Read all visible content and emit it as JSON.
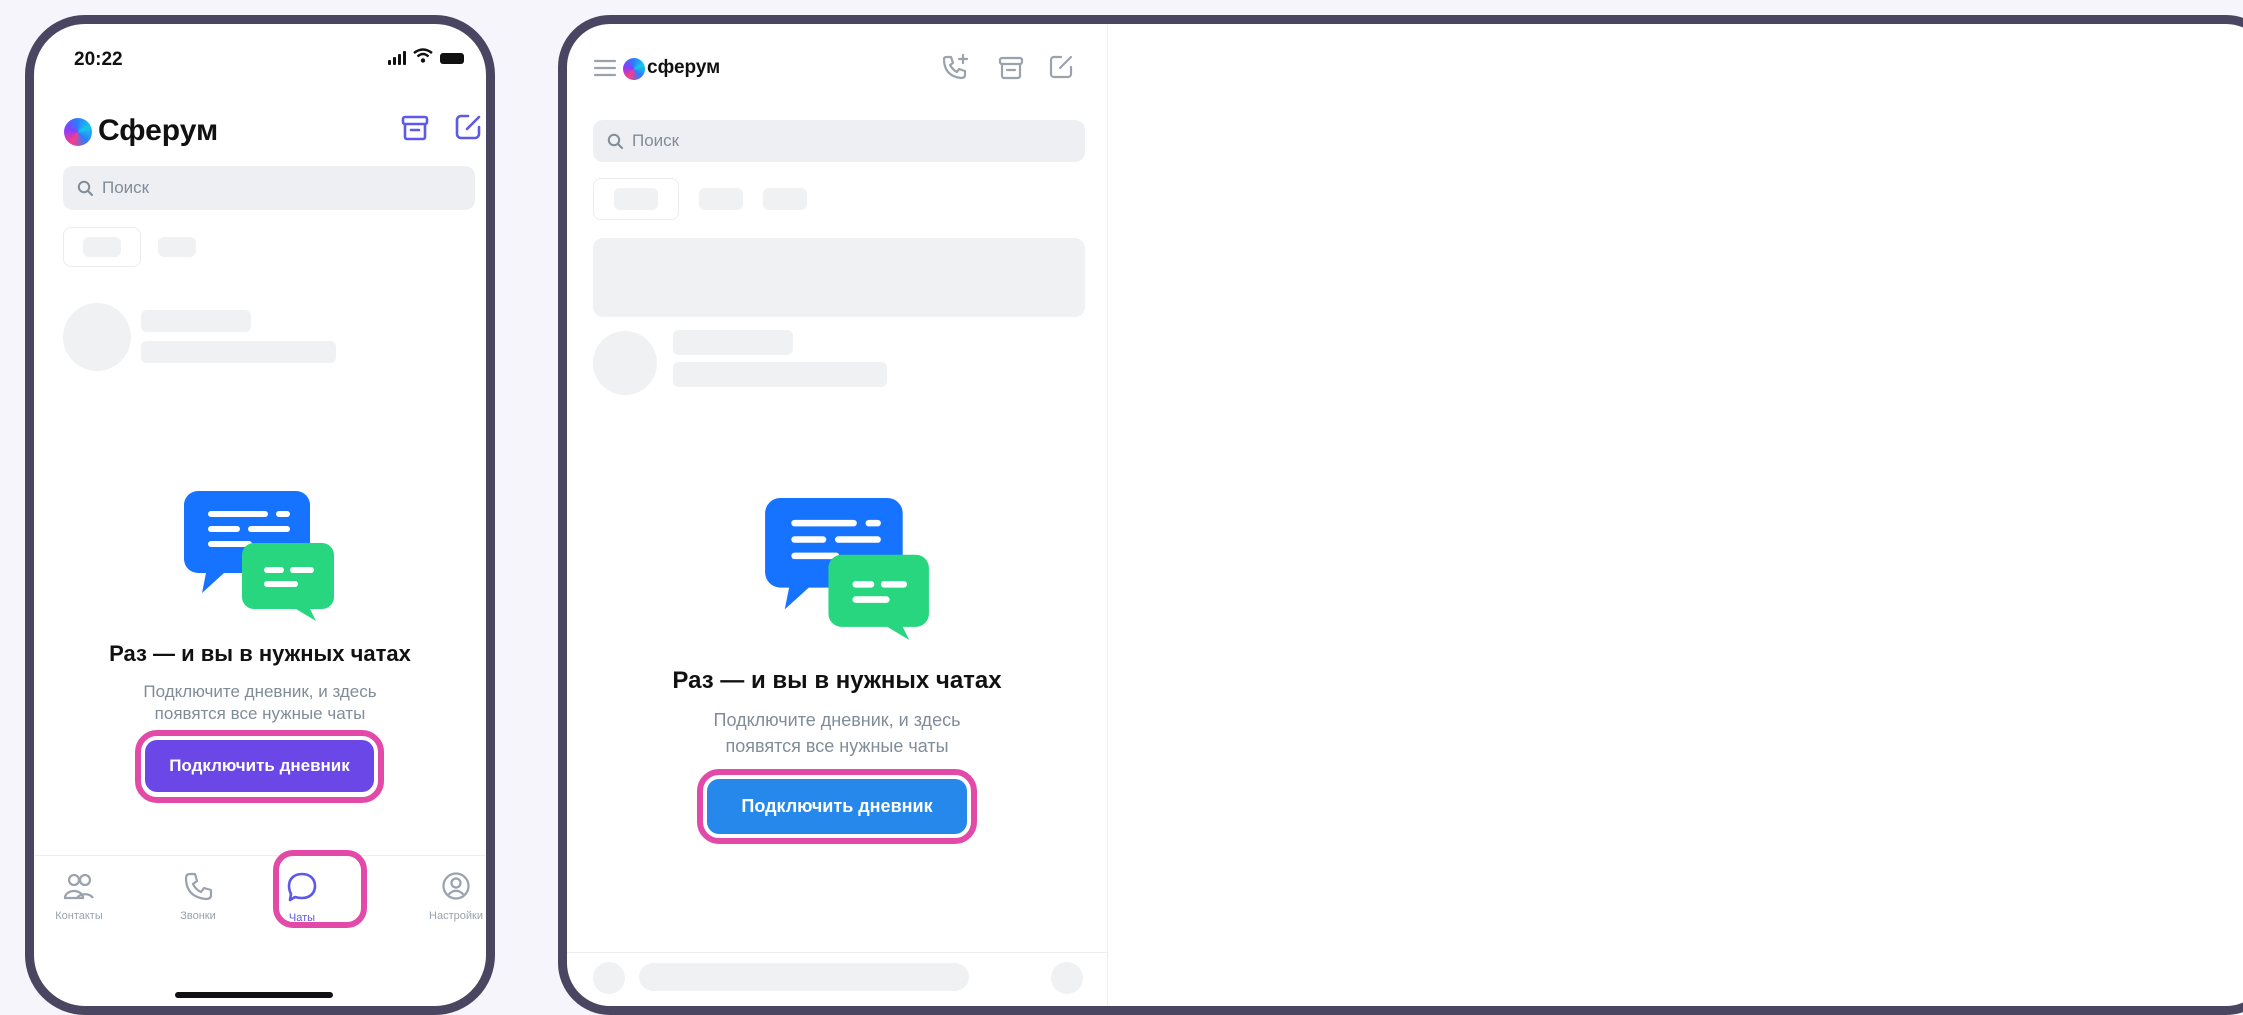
{
  "colors": {
    "frame": "#4a4560",
    "page_bg": "#f6f5fc",
    "highlight": "#e34aa7",
    "phone_cta": "#6a47e6",
    "desktop_cta": "#2688eb",
    "accent_icon": "#5d59e9",
    "skeleton": "#f0f1f3",
    "bubble_blue": "#1673ff",
    "bubble_green": "#27d67f"
  },
  "phone": {
    "status_time": "20:22",
    "app_title": "Сферум",
    "icons": {
      "archive": "archive-icon",
      "compose": "compose-icon"
    },
    "search_placeholder": "Поиск",
    "empty_title": "Раз — и вы в нужных чатах",
    "empty_subtitle_line1": "Подключите дневник, и здесь",
    "empty_subtitle_line2": "появятся все нужные чаты",
    "cta_label": "Подключить дневник",
    "tabs": [
      {
        "label": "Контакты",
        "icon": "contacts-icon"
      },
      {
        "label": "Звонки",
        "icon": "phone-icon"
      },
      {
        "label": "Чаты",
        "icon": "chat-icon",
        "active": true
      },
      {
        "label": "Настройки",
        "icon": "profile-icon"
      }
    ]
  },
  "desktop": {
    "brand": "сферум",
    "icons": {
      "menu": "menu-icon",
      "call_add": "call-add-icon",
      "archive": "archive-icon",
      "compose": "compose-icon"
    },
    "search_placeholder": "Поиск",
    "empty_title": "Раз — и вы в нужных чатах",
    "empty_subtitle_line1": "Подключите дневник, и здесь",
    "empty_subtitle_line2": "появятся все нужные чаты",
    "cta_label": "Подключить дневник"
  }
}
